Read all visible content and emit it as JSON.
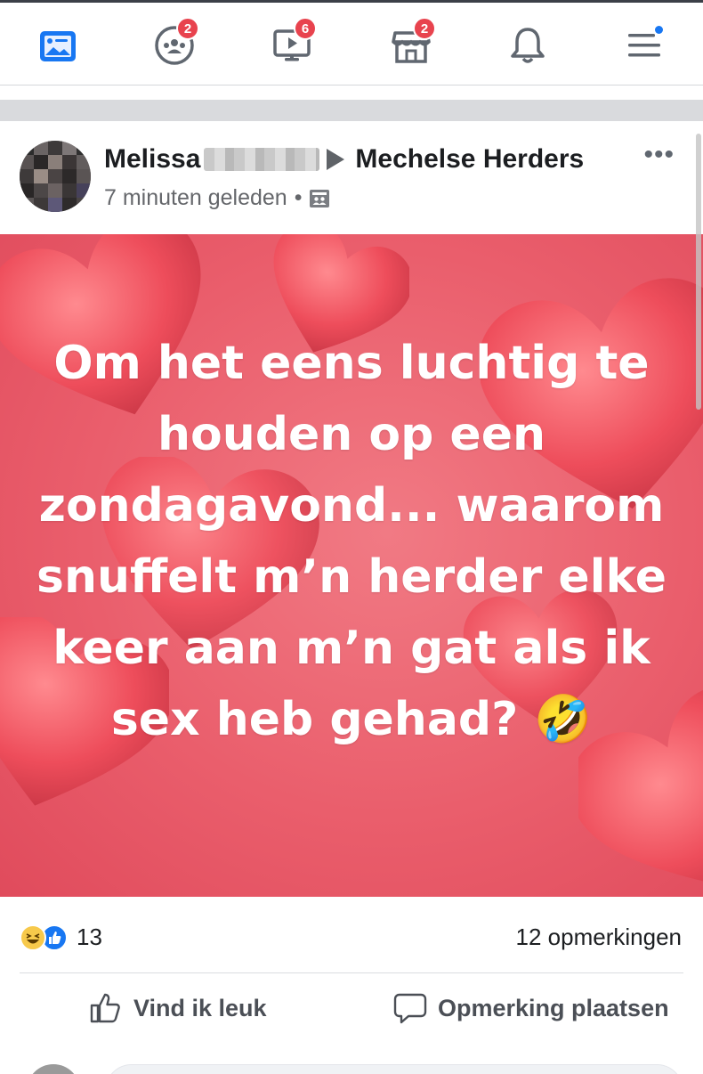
{
  "nav": {
    "items": [
      {
        "name": "news-feed",
        "icon": "news-feed-icon",
        "badge": ""
      },
      {
        "name": "groups",
        "icon": "groups-icon",
        "badge": "2"
      },
      {
        "name": "watch",
        "icon": "video-icon",
        "badge": "6"
      },
      {
        "name": "marketplace",
        "icon": "marketplace-icon",
        "badge": "2"
      },
      {
        "name": "notifications",
        "icon": "bell-icon",
        "badge": ""
      },
      {
        "name": "menu",
        "icon": "menu-icon",
        "badge": ""
      }
    ],
    "active_color": "#1877f2",
    "badge_color": "#e8434e"
  },
  "post": {
    "author": "Melissa",
    "target": "Mechelse Herders",
    "time": "7 minuten geleden",
    "privacy_icon": "group-audience-icon",
    "more_label": "•••",
    "text": "Om het eens luchtig te houden op een zondagavond... waarom snuffelt m’n herder elke keer aan m’n gat als ik sex heb gehad? 🤣",
    "background_color": "#ea5e6c",
    "reactions": {
      "types": [
        "haha",
        "like"
      ],
      "count": "13"
    },
    "comments_label": "12 opmerkingen",
    "actions": {
      "like_label": "Vind ik leuk",
      "comment_label": "Opmerking plaatsen"
    }
  }
}
